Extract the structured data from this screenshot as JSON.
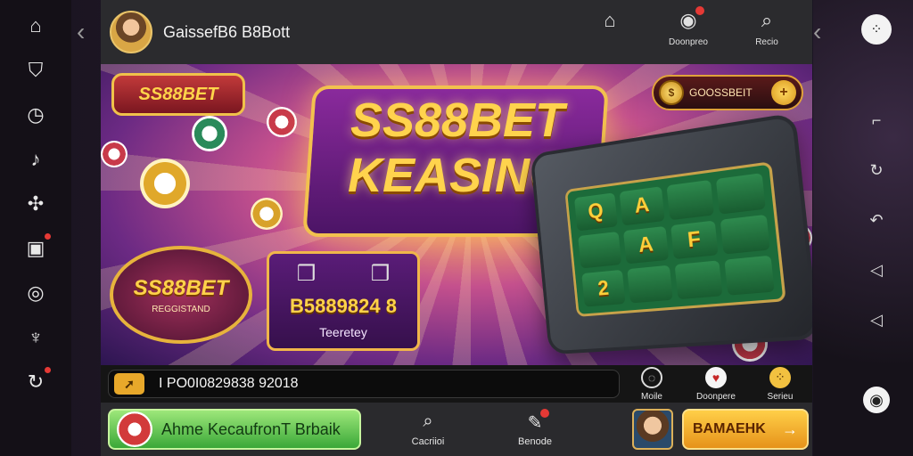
{
  "topbar": {
    "brand_title": "GaissefB6 B8Bott",
    "actions": [
      {
        "label": "",
        "icon": "home-icon"
      },
      {
        "label": "Doonpreo",
        "icon": "notifications-icon"
      },
      {
        "label": "Recio",
        "icon": "search-icon"
      }
    ]
  },
  "hero": {
    "logo_text": "SS88BET",
    "title_line1": "SS88BET",
    "title_line2": "KEASINO",
    "coin_pill_text": "GOOSSBEIT",
    "promo_badge_title": "SS88BET",
    "promo_badge_sub": "REGGISTAND",
    "promo_card_number": "B5889824 8",
    "promo_card_label": "Teeretey",
    "reel_symbols": [
      "Q",
      "A",
      "",
      "",
      "",
      "A",
      "F",
      "",
      "2",
      "",
      "",
      ""
    ]
  },
  "info_strip": {
    "ticker_text": "I PO0I0829838 92018",
    "actions": [
      {
        "label": "Moile",
        "icon": "chat-icon"
      },
      {
        "label": "Doonpere",
        "icon": "gift-icon"
      },
      {
        "label": "Serieu",
        "icon": "settings-icon"
      }
    ]
  },
  "bottombar": {
    "cta_green_text": "Ahme KecaufronT Brbaik",
    "nav": [
      {
        "label": "Cacriioi",
        "icon": "chat-icon"
      },
      {
        "label": "Benode",
        "icon": "edit-icon"
      }
    ],
    "cta_gold_text": "BAMAEHK"
  },
  "colors": {
    "accent_gold": "#f0c24a",
    "cta_green": "#3aa838",
    "cta_gold": "#e6921a",
    "badge_red": "#e53935"
  }
}
